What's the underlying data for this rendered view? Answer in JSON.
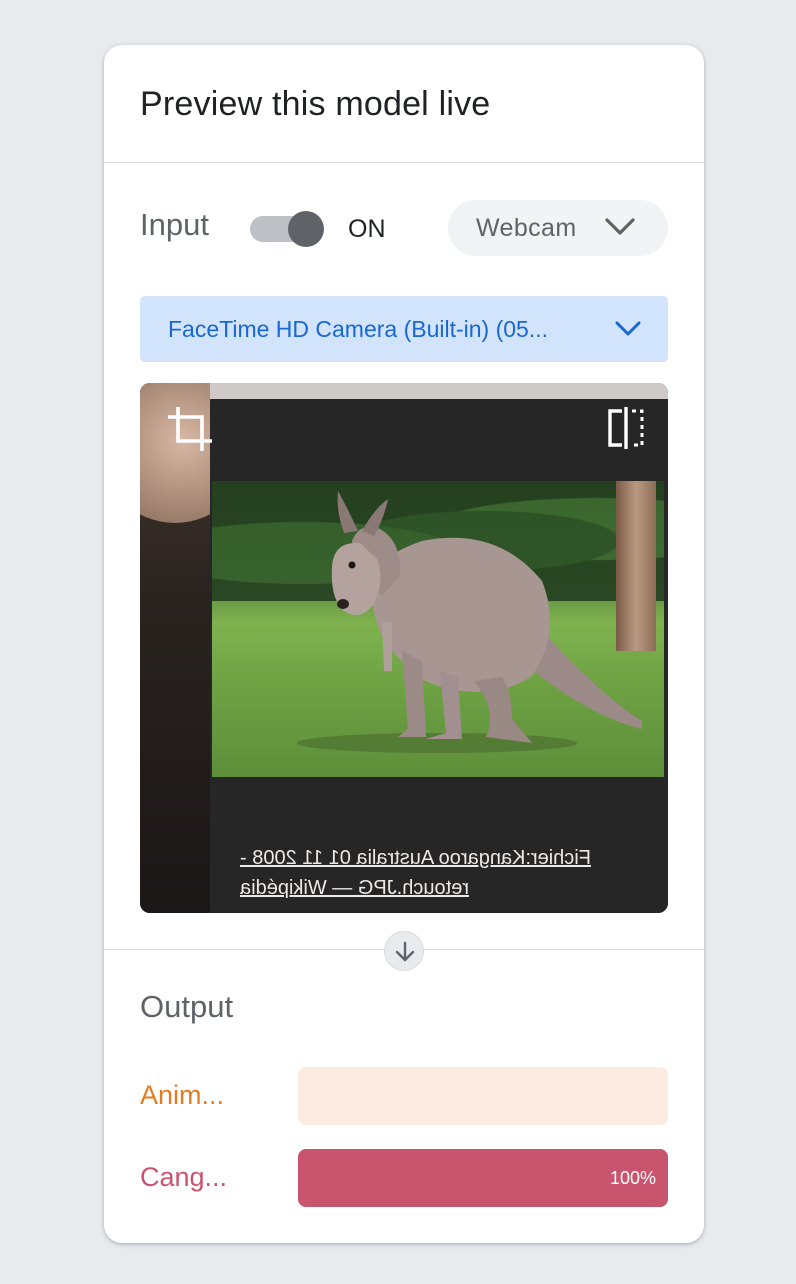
{
  "panel": {
    "title": "Preview this model live"
  },
  "input": {
    "label": "Input",
    "toggle_state": "ON",
    "toggle_on": true,
    "source_value": "Webcam",
    "camera_value": "FaceTime HD Camera (Built-in) (05...",
    "preview_caption": "Fichier:Kangaroo Australia 01 11 2008 - retouch.JPG — Wikipédia"
  },
  "output": {
    "label": "Output",
    "classes": [
      {
        "name": "Anim...",
        "confidence": 0,
        "percent_label": "",
        "color": "#e67c22",
        "bar_bg": "#fbebe1",
        "bar_fill": "#e67c22"
      },
      {
        "name": "Cang...",
        "confidence": 1.0,
        "percent_label": "100%",
        "color": "#c9546d",
        "bar_bg": "#f6dfe4",
        "bar_fill": "#c9546d"
      }
    ]
  },
  "colors": {
    "page_bg": "#e8eaed",
    "accent_blue": "#1967d2",
    "camera_select_bg": "#d2e3fc"
  },
  "icons": {
    "crop": "crop-icon",
    "flip": "flip-horizontal-icon",
    "source_chevron": "chevron-down-icon",
    "camera_chevron": "chevron-down-icon",
    "flow_arrow": "arrow-down-icon"
  }
}
